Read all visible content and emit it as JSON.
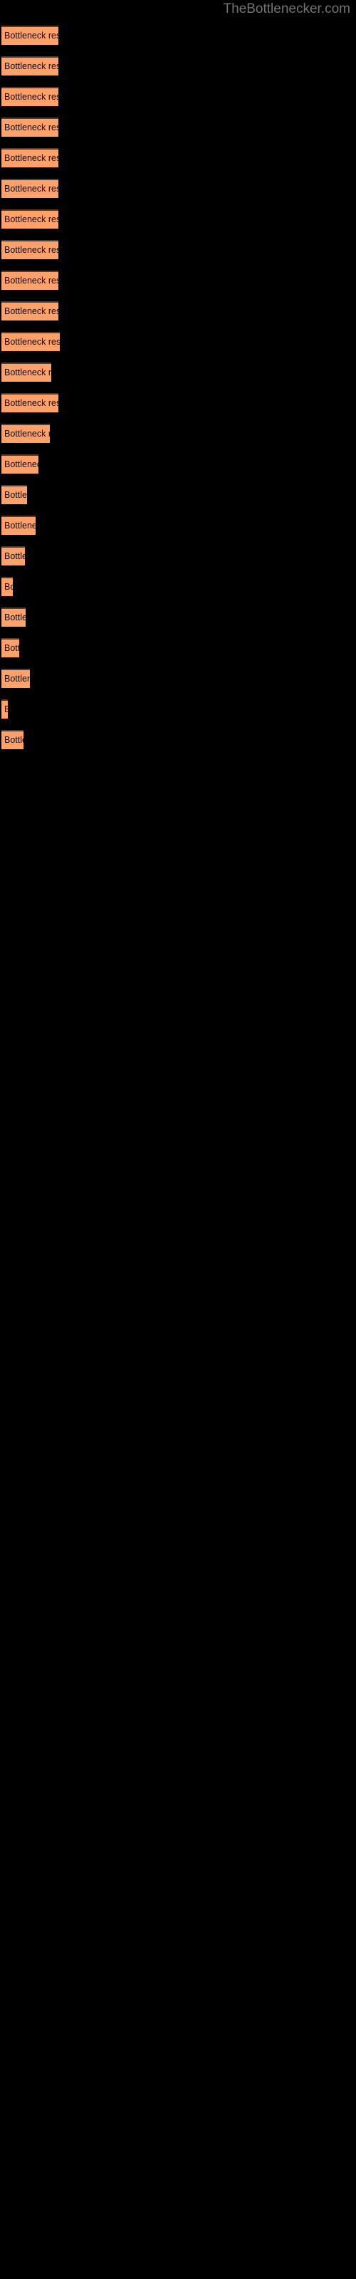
{
  "site": {
    "title": "TheBottlenecker.com",
    "title_color": "#737373"
  },
  "background_color": "#000000",
  "chart_data": {
    "type": "bar",
    "orientation": "horizontal",
    "title": "",
    "xlabel": "",
    "ylabel": "",
    "bar_color": "#fca16a",
    "bar_border_color": "#5a3a28",
    "label_color": "#0b0b0b",
    "grid": false,
    "legend": false,
    "axis_visible": false,
    "xlim": [
      0,
      500
    ],
    "categories": [
      "Bottleneck result",
      "Bottleneck result",
      "Bottleneck result",
      "Bottleneck result",
      "Bottleneck result",
      "Bottleneck result",
      "Bottleneck result",
      "Bottleneck result",
      "Bottleneck result",
      "Bottleneck result",
      "Bottleneck result",
      "Bottleneck result",
      "Bottleneck result",
      "Bottleneck result",
      "Bottleneck result",
      "Bottleneck result",
      "Bottleneck result",
      "Bottleneck result",
      "Bottleneck result",
      "Bottleneck result",
      "Bottleneck result",
      "Bottleneck result",
      "Bottleneck result"
    ],
    "values": [
      80,
      80,
      80,
      80,
      80,
      80,
      80,
      80,
      80,
      80,
      80,
      72,
      80,
      70,
      53,
      37,
      48,
      35,
      18,
      36,
      26,
      42,
      10,
      33
    ],
    "bars": [
      {
        "label": "Bottleneck result",
        "width": 80
      },
      {
        "label": "Bottleneck result",
        "width": 80
      },
      {
        "label": "Bottleneck result",
        "width": 80
      },
      {
        "label": "Bottleneck result",
        "width": 80
      },
      {
        "label": "Bottleneck result",
        "width": 80
      },
      {
        "label": "Bottleneck result",
        "width": 80
      },
      {
        "label": "Bottleneck result",
        "width": 80
      },
      {
        "label": "Bottleneck result",
        "width": 80
      },
      {
        "label": "Bottleneck result",
        "width": 80
      },
      {
        "label": "Bottleneck result",
        "width": 80
      },
      {
        "label": "Bottleneck result",
        "width": 82
      },
      {
        "label": "Bottleneck result",
        "width": 70
      },
      {
        "label": "Bottleneck result",
        "width": 80
      },
      {
        "label": "Bottleneck result",
        "width": 68
      },
      {
        "label": "Bottleneck result",
        "width": 52
      },
      {
        "label": "Bottleneck result",
        "width": 36
      },
      {
        "label": "Bottleneck result",
        "width": 48
      },
      {
        "label": "Bottleneck result",
        "width": 33
      },
      {
        "label": "Bottleneck result",
        "width": 16
      },
      {
        "label": "Bottleneck result",
        "width": 34
      },
      {
        "label": "Bottleneck result",
        "width": 25
      },
      {
        "label": "Bottleneck result",
        "width": 40
      },
      {
        "label": "Bottleneck result",
        "width": 9
      },
      {
        "label": "Bottleneck result",
        "width": 31
      }
    ]
  }
}
